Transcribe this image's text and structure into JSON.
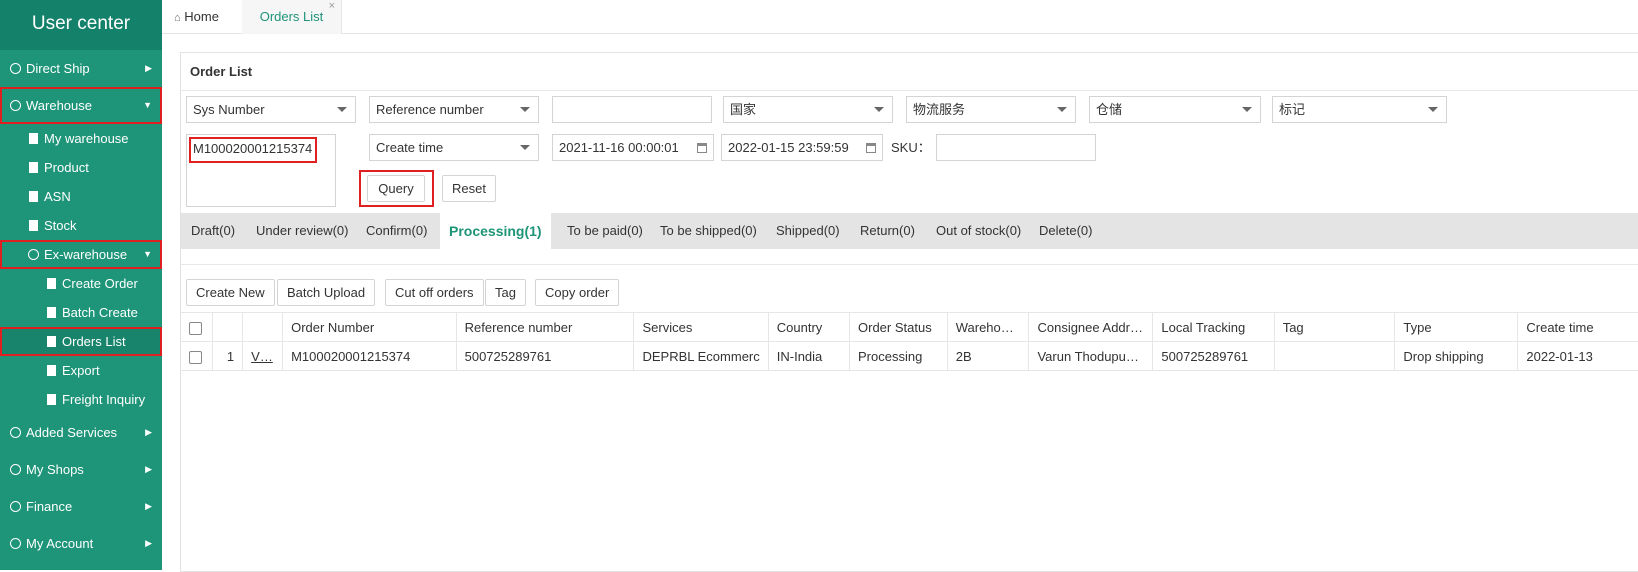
{
  "sidebar": {
    "brand": "User center",
    "direct_ship": "Direct Ship",
    "warehouse": "Warehouse",
    "warehouse_items": [
      "My warehouse",
      "Product",
      "ASN",
      "Stock"
    ],
    "ex_warehouse": "Ex-warehouse",
    "ex_items": [
      "Create Order",
      "Batch Create",
      "Orders List",
      "Export",
      "Freight Inquiry"
    ],
    "added_services": "Added Services",
    "my_shops": "My Shops",
    "finance": "Finance",
    "my_account": "My Account"
  },
  "tabs": {
    "home": "Home",
    "orders": "Orders List",
    "close": "×"
  },
  "panel": {
    "title": "Order List"
  },
  "filters": {
    "sys_number": "Sys Number",
    "reference_number": "Reference number",
    "country": "国家",
    "logistics": "物流服务",
    "warehousing": "仓储",
    "mark": "标记",
    "sys_number_value": "M100020001215374",
    "create_time": "Create time",
    "start_date": "2021-11-16 00:00:01",
    "end_date": "2022-01-15 23:59:59",
    "sku_label": "SKU：",
    "query": "Query",
    "reset": "Reset"
  },
  "status_tabs": [
    "Draft(0)",
    "Under review(0)",
    "Confirm(0)",
    "Processing(1)",
    "To be paid(0)",
    "To be shipped(0)",
    "Shipped(0)",
    "Return(0)",
    "Out of stock(0)",
    "Delete(0)"
  ],
  "actions": [
    "Create New",
    "Batch Upload",
    "Cut off orders",
    "Tag",
    "Copy order"
  ],
  "table": {
    "headers": [
      "",
      "",
      "",
      "Order Number",
      "Reference number",
      "Services",
      "Country",
      "Order Status",
      "Wareho…",
      "Consignee Addr…",
      "Local Tracking",
      "Tag",
      "Type",
      "Create time"
    ],
    "rows": [
      [
        "",
        "1",
        "V…",
        "M100020001215374",
        "500725289761",
        "DEPRBL Ecommerc",
        "IN-India",
        "Processing",
        "2B",
        "Varun Thodupu…",
        "500725289761",
        "",
        "Drop shipping",
        "2022-01-13"
      ]
    ]
  },
  "colors": {
    "sidebar": "#1e9478",
    "accent": "#1e9478",
    "highlight": "#e02020"
  }
}
